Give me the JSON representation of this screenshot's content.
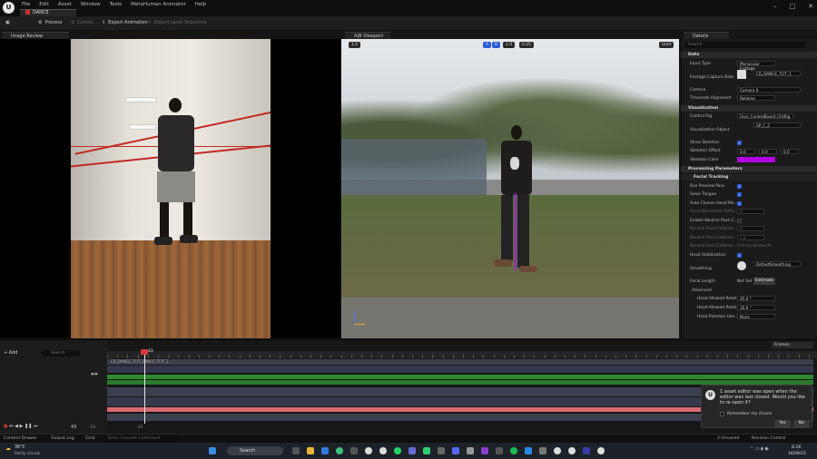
{
  "menu": [
    "File",
    "Edit",
    "Asset",
    "Window",
    "Tools",
    "MetaHuman Animator",
    "Help"
  ],
  "doc_tab": "DANCE",
  "toolbar": {
    "process": "Process",
    "cancel": "Cancel",
    "export_anim": "Export Animation",
    "export_seq": "Export Level Sequence"
  },
  "panels": {
    "image_review": "Image Review",
    "viewport": "A|B Viewport",
    "details": "Details"
  },
  "viewport": {
    "chip_a": "A",
    "chip_b": "B",
    "chip_1": "1.0",
    "chip_lod": "0.25",
    "chip_unlit": "Unlit",
    "chip_left": "1.0"
  },
  "details": {
    "search_placeholder": "Search",
    "sections": {
      "data": "Data",
      "visualization": "Visualization",
      "processing": "Processing Parameters",
      "facial": "Facial Tracking",
      "advanced": "Advanced"
    },
    "props": {
      "input_type": "Input Type",
      "input_type_v": "Monocular Footage",
      "footage": "Footage Capture Data",
      "footage_v": "CD_DANCE_TCIT_1",
      "camera": "Camera",
      "camera_v": "Camera 0",
      "timecode": "Timecode Alignment",
      "timecode_v": "Relative",
      "control_rig": "Control Rig",
      "control_rig_v": "Face_ControlBoard_CtrlRig",
      "vis_obj": "Visualization Object",
      "vis_obj_v": "SP_C_2",
      "show_skel": "Show Skeleton",
      "skel_offset": "Skeleton Offset",
      "off_x": "0.0",
      "off_y": "0.0",
      "off_z": "0.0",
      "skel_color": "Skeleton Color",
      "run_preview": "Run Preview Pass",
      "solve_tongue": "Solve Tongue",
      "auto_head": "Auto Choose Head Mo...",
      "head_move": "Head Movement Reflo...",
      "head_move_v": "0",
      "enable_neutral": "Enable Neutral Pose C...",
      "neutral_cal": "Neutral Pose Calibrati...",
      "neutral_cal_v": "0",
      "neutral_cal2": "Neutral Pose Calibrati...",
      "neutral_cal2_v": "1.0",
      "neutral_cal3": "Neutral Pose Calibrati...",
      "neutral_cal3_v": "0 Array elements",
      "head_stab": "Head Stabilization",
      "smoothing": "Smoothing",
      "smoothing_v": "DefaultSmoothing",
      "focal": "Focal Length",
      "focal_v": "Not Set",
      "estimate": "Estimate",
      "rot1": "Head Allowed Rotat...",
      "rot1_v": "45.0 °",
      "rot2": "Head Allowed Rotat...",
      "rot2_v": "30.0 °",
      "rot3": "Head Rotation Han...",
      "rot3_v": "None"
    },
    "skel_color_hex": "#b000e0"
  },
  "timeline": {
    "add": "+ Add",
    "frame_label": "Frames",
    "playhead": "43",
    "current_frame": "43",
    "start": "-25",
    "mid": "-25",
    "end": "25",
    "track_label": "CD_DANCE_TCIT_DANCE_TCIT_1",
    "filter_placeholder": "Search"
  },
  "popup": {
    "msg": "1 asset editor was open when the editor was last closed. Would you like to re-open it?",
    "remember": "Remember my choice",
    "yes": "Yes",
    "no": "No"
  },
  "status": {
    "drawer": "Content Drawer",
    "output": "Output Log",
    "cmd": "Cmd",
    "cmd_placeholder": "Enter Console Command",
    "unsaved": "2 Unsaved",
    "revision": "Revision Control"
  },
  "taskbar": {
    "search": "Search",
    "weather_temp": "36°C",
    "weather_desc": "Partly cloudy",
    "time": "8:26",
    "date": "18/09/23"
  }
}
